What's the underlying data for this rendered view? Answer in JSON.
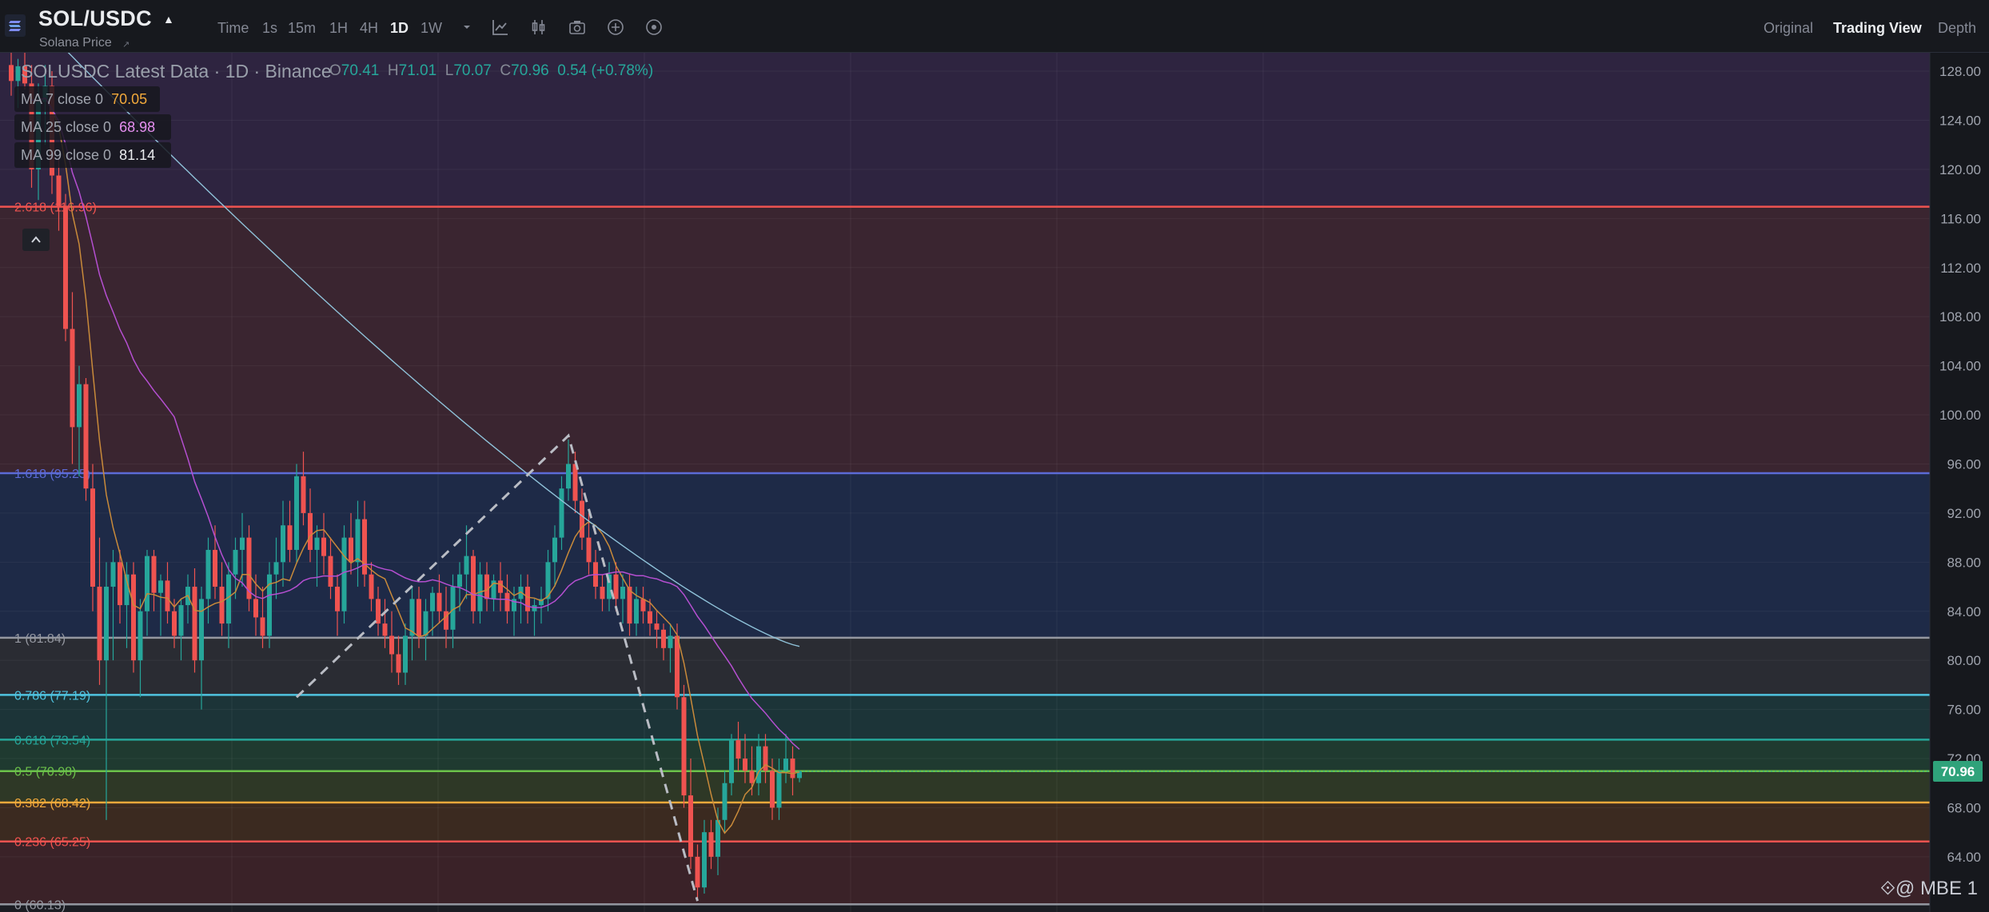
{
  "header": {
    "symbol": "SOL/USDC",
    "subtitle": "Solana Price",
    "intervals": [
      {
        "label": "Time",
        "active": false
      },
      {
        "label": "1s",
        "active": false
      },
      {
        "label": "15m",
        "active": false
      },
      {
        "label": "1H",
        "active": false
      },
      {
        "label": "4H",
        "active": false
      },
      {
        "label": "1D",
        "active": true
      },
      {
        "label": "1W",
        "active": false
      }
    ],
    "tool_icons": [
      "chevron-down-icon",
      "indicator-chart-icon",
      "candle-type-icon",
      "camera-icon",
      "plus-circle-icon",
      "settings-circle-icon"
    ],
    "views": [
      {
        "label": "Original",
        "active": false
      },
      {
        "label": "Trading View",
        "active": true
      },
      {
        "label": "Depth",
        "active": false
      }
    ]
  },
  "legend": {
    "title": "SOLUSDC Latest Data · 1D · Binance",
    "ohlc": {
      "o_label": "O",
      "o": "70.41",
      "h_label": "H",
      "h": "71.01",
      "l_label": "L",
      "l": "70.07",
      "c_label": "C",
      "c": "70.96",
      "change": "0.54 (+0.78%)"
    },
    "ma": [
      {
        "label": "MA 7 close 0",
        "value": "70.05",
        "color": "#f2a93b"
      },
      {
        "label": "MA 25 close 0",
        "value": "68.98",
        "color": "#d05ce3"
      },
      {
        "label": "MA 99 close 0",
        "value": "81.14",
        "color": "#eaecef"
      }
    ]
  },
  "colors": {
    "up": "#26a69a",
    "down": "#ef5350",
    "ma7": "#c98a3a",
    "ma25": "#b54fd1",
    "ma99": "#8fc2d9",
    "price_tag_bg": "#2fa27a"
  },
  "watermark": "⟐@ MBE 1",
  "chart_data": {
    "type": "candlestick",
    "symbol": "SOLUSDC",
    "timeframe": "1D",
    "exchange": "Binance",
    "ylim": [
      59.5,
      129.5
    ],
    "y_ticks": [
      "128.00",
      "124.00",
      "120.00",
      "116.00",
      "112.00",
      "108.00",
      "104.00",
      "100.00",
      "96.00",
      "92.00",
      "88.00",
      "84.00",
      "80.00",
      "76.00",
      "72.00",
      "68.00",
      "64.00"
    ],
    "last_price": "70.96",
    "fib_levels": [
      {
        "label": "2.618 (116.96)",
        "value": 116.96,
        "color": "#ef5350"
      },
      {
        "label": "1.618 (95.25)",
        "value": 95.25,
        "color": "#5c6bd6"
      },
      {
        "label": "1 (81.84)",
        "value": 81.84,
        "color": "#9598a1"
      },
      {
        "label": "0.786 (77.19)",
        "value": 77.19,
        "color": "#4fc3e0"
      },
      {
        "label": "0.618 (73.54)",
        "value": 73.54,
        "color": "#26a69a"
      },
      {
        "label": "0.5 (70.98)",
        "value": 70.98,
        "color": "#6cc24a"
      },
      {
        "label": "0.382 (68.42)",
        "value": 68.42,
        "color": "#f2a93b"
      },
      {
        "label": "0.236 (65.25)",
        "value": 65.25,
        "color": "#ef5350"
      },
      {
        "label": "0 (60.13)",
        "value": 60.13,
        "color": "#9598a1"
      }
    ],
    "zones": [
      {
        "from": 116.96,
        "to": 130,
        "color": "#2e2440"
      },
      {
        "from": 95.25,
        "to": 116.96,
        "color": "#3a2530"
      },
      {
        "from": 81.84,
        "to": 95.25,
        "color": "#1e2a47"
      },
      {
        "from": 77.19,
        "to": 81.84,
        "color": "#2a2c33"
      },
      {
        "from": 73.54,
        "to": 77.19,
        "color": "#1c3438"
      },
      {
        "from": 70.98,
        "to": 73.54,
        "color": "#1f3a30"
      },
      {
        "from": 68.42,
        "to": 70.98,
        "color": "#2e3826"
      },
      {
        "from": 65.25,
        "to": 68.42,
        "color": "#3b2a20"
      },
      {
        "from": 60.13,
        "to": 65.25,
        "color": "#3a2228"
      }
    ],
    "candles": [
      [
        128.5,
        130,
        126,
        127.2
      ],
      [
        127.2,
        129,
        125,
        128.4
      ],
      [
        128.4,
        129.5,
        126.5,
        127
      ],
      [
        127,
        128.5,
        118.5,
        120
      ],
      [
        120,
        127,
        117.5,
        125.5
      ],
      [
        125.5,
        128.5,
        122,
        126.8
      ],
      [
        126.8,
        128,
        118,
        119.5
      ],
      [
        119.5,
        121,
        115,
        117
      ],
      [
        117,
        118,
        106,
        107
      ],
      [
        107,
        110,
        96,
        99
      ],
      [
        99,
        104,
        95,
        102.5
      ],
      [
        102.5,
        103,
        93,
        94
      ],
      [
        94,
        96,
        84,
        86
      ],
      [
        86,
        90,
        78,
        80
      ],
      [
        80,
        88,
        67,
        86
      ],
      [
        86,
        89,
        80,
        88
      ],
      [
        88,
        89,
        83,
        84.5
      ],
      [
        84.5,
        88,
        81,
        87
      ],
      [
        87,
        88,
        79,
        80
      ],
      [
        80,
        85,
        77,
        84
      ],
      [
        84,
        89,
        82,
        88.5
      ],
      [
        88.5,
        89,
        84,
        85.5
      ],
      [
        85.5,
        87,
        82,
        86.5
      ],
      [
        86.5,
        88,
        83,
        84
      ],
      [
        84,
        85,
        81,
        82
      ],
      [
        82,
        85,
        80,
        84.5
      ],
      [
        84.5,
        87,
        83,
        86
      ],
      [
        86,
        87.5,
        79,
        80
      ],
      [
        80,
        86,
        76,
        85
      ],
      [
        85,
        90,
        83,
        89
      ],
      [
        89,
        91,
        85,
        86
      ],
      [
        86,
        88,
        82,
        83
      ],
      [
        83,
        88,
        81,
        87
      ],
      [
        87,
        90,
        85,
        89
      ],
      [
        89,
        92,
        86,
        90
      ],
      [
        90,
        91,
        84,
        85
      ],
      [
        85,
        87,
        82,
        83.5
      ],
      [
        83.5,
        86,
        81,
        82
      ],
      [
        82,
        88,
        81,
        87
      ],
      [
        87,
        90,
        85,
        88
      ],
      [
        88,
        93,
        86,
        91
      ],
      [
        91,
        93,
        88,
        89
      ],
      [
        89,
        96,
        88,
        95
      ],
      [
        95,
        97,
        91,
        92
      ],
      [
        92,
        94,
        88,
        89
      ],
      [
        89,
        91,
        86,
        90
      ],
      [
        90,
        92,
        87,
        88.5
      ],
      [
        88.5,
        90,
        85,
        86
      ],
      [
        86,
        87,
        82,
        84
      ],
      [
        84,
        91,
        83,
        90
      ],
      [
        90,
        92,
        87,
        88
      ],
      [
        88,
        93,
        86,
        91.5
      ],
      [
        91.5,
        93,
        86,
        87
      ],
      [
        87,
        88,
        84,
        85
      ],
      [
        85,
        86,
        82,
        83
      ],
      [
        83,
        85,
        81,
        82
      ],
      [
        82,
        84,
        79,
        80.5
      ],
      [
        80.5,
        82,
        78,
        79
      ],
      [
        79,
        83,
        78,
        82
      ],
      [
        82,
        86,
        80,
        85
      ],
      [
        85,
        86,
        81,
        82
      ],
      [
        82,
        85,
        80,
        84
      ],
      [
        84,
        86,
        82,
        85.5
      ],
      [
        85.5,
        87,
        83,
        84
      ],
      [
        84,
        86,
        81,
        82.5
      ],
      [
        82.5,
        87,
        81,
        86
      ],
      [
        86,
        88,
        84,
        87
      ],
      [
        87,
        91,
        85,
        88.5
      ],
      [
        88.5,
        89,
        83,
        84
      ],
      [
        84,
        88,
        83,
        87
      ],
      [
        87,
        88,
        84,
        85
      ],
      [
        85,
        87,
        84,
        86.5
      ],
      [
        86.5,
        88,
        84,
        85.5
      ],
      [
        85.5,
        87,
        83,
        84
      ],
      [
        84,
        86,
        82,
        85
      ],
      [
        85,
        87,
        83,
        86
      ],
      [
        86,
        87,
        83,
        84
      ],
      [
        84,
        85,
        82,
        84.5
      ],
      [
        84.5,
        86,
        83,
        85
      ],
      [
        85,
        89,
        84,
        88
      ],
      [
        88,
        91,
        86,
        90
      ],
      [
        90,
        95,
        89,
        94
      ],
      [
        94,
        98,
        93,
        96
      ],
      [
        96,
        97,
        92,
        93
      ],
      [
        93,
        94,
        89,
        90
      ],
      [
        90,
        92,
        87,
        88
      ],
      [
        88,
        89,
        85,
        86
      ],
      [
        86,
        87,
        84,
        85
      ],
      [
        85,
        88,
        84,
        87
      ],
      [
        87,
        88,
        84,
        85
      ],
      [
        85,
        87,
        83,
        86
      ],
      [
        86,
        87,
        82,
        83
      ],
      [
        83,
        86,
        82,
        85
      ],
      [
        85,
        86,
        83,
        84
      ],
      [
        84,
        85,
        82,
        83
      ],
      [
        83,
        84,
        81,
        82.5
      ],
      [
        82.5,
        83,
        80,
        81
      ],
      [
        81,
        83,
        79,
        82
      ],
      [
        82,
        83,
        76,
        77
      ],
      [
        77,
        78,
        68,
        69
      ],
      [
        69,
        72,
        63,
        64
      ],
      [
        64,
        65,
        60.5,
        61.5
      ],
      [
        61.5,
        67,
        61,
        66
      ],
      [
        66,
        67,
        63,
        64
      ],
      [
        64,
        68,
        62.5,
        67
      ],
      [
        67,
        71,
        66,
        70
      ],
      [
        70,
        74,
        69,
        73.5
      ],
      [
        73.5,
        75,
        71,
        72
      ],
      [
        72,
        74,
        70,
        71
      ],
      [
        71,
        73,
        69,
        70
      ],
      [
        70,
        74,
        69,
        73
      ],
      [
        73,
        74,
        70,
        71
      ],
      [
        71,
        72,
        67,
        68
      ],
      [
        68,
        72,
        67,
        71
      ],
      [
        71,
        74,
        70,
        72
      ],
      [
        72,
        73,
        69,
        70.41
      ],
      [
        70.41,
        71.01,
        70.07,
        70.96
      ]
    ],
    "dashed_path": [
      {
        "i": 42,
        "v": 77.0
      },
      {
        "i": 82,
        "v": 98.3
      },
      {
        "i": 101,
        "v": 60.4
      }
    ]
  }
}
